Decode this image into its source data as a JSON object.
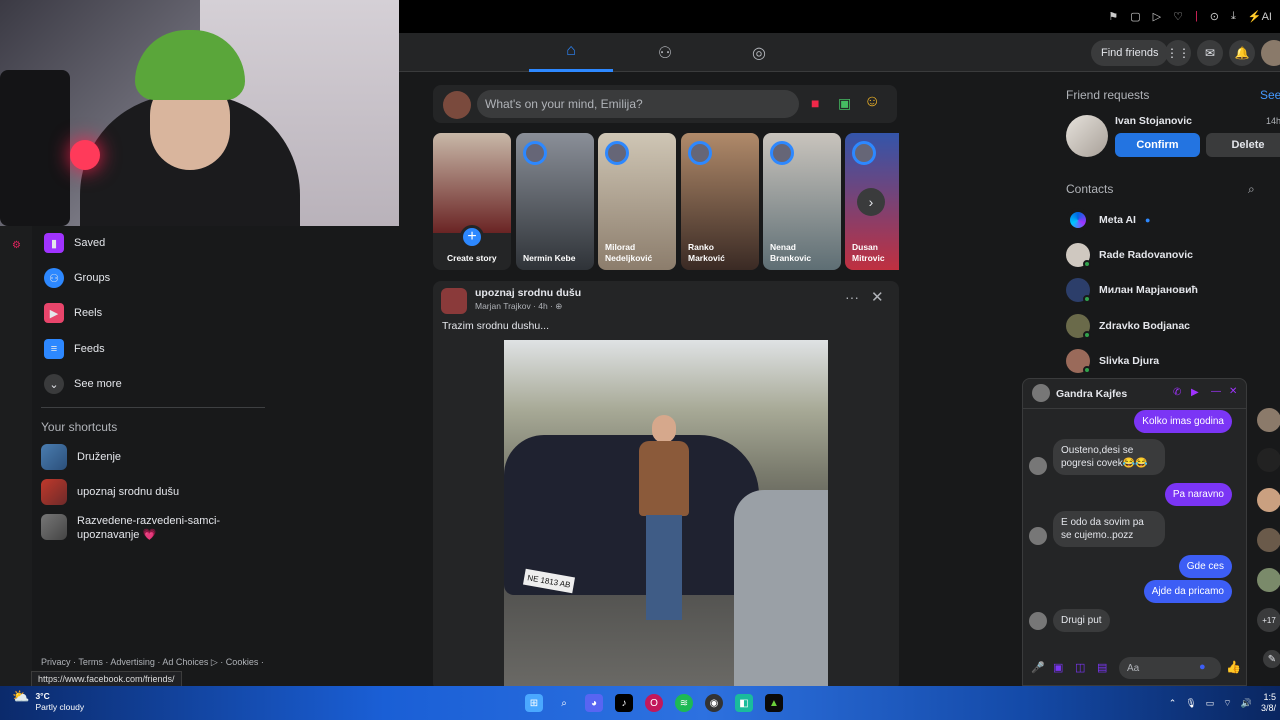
{
  "browser": {
    "extension_icons": [
      "bookmark-icon",
      "window-icon",
      "play-icon",
      "heart-icon",
      "download-icon",
      "sync-icon",
      "ai-icon"
    ],
    "ai_label": "AI",
    "status_url": "https://www.facebook.com/friends/"
  },
  "nav": {
    "tabs": [
      {
        "name": "home",
        "icon": "⌂",
        "active": true
      },
      {
        "name": "friends",
        "icon": "👥",
        "active": false
      },
      {
        "name": "groups",
        "icon": "◎",
        "active": false
      }
    ],
    "find_friends": "Find friends",
    "accent": "#2d88ff"
  },
  "left_menu": {
    "items": [
      {
        "label": "Saved",
        "icon": "bookmark-icon",
        "color": "#a033ff"
      },
      {
        "label": "Groups",
        "icon": "groups-icon",
        "color": "#2d88ff"
      },
      {
        "label": "Reels",
        "icon": "reels-icon",
        "color": "#e8456b"
      },
      {
        "label": "Feeds",
        "icon": "feeds-icon",
        "color": "#2d88ff"
      },
      {
        "label": "See more",
        "icon": "chevron-down-icon",
        "color": "#3a3b3c"
      }
    ],
    "shortcuts_title": "Your shortcuts",
    "shortcuts": [
      {
        "label": "Druženje"
      },
      {
        "label": "upoznaj srodnu dušu"
      },
      {
        "label_line1": "Razvedene-razvedeni-samci-",
        "label_line2": "upoznavanje 💗"
      }
    ],
    "footer": "Privacy · Terms · Advertising · Ad Choices ▷ · Cookies ·"
  },
  "composer": {
    "placeholder": "What's on your mind, Emilija?"
  },
  "stories": [
    {
      "name": "Create story",
      "type": "create"
    },
    {
      "name": "Nermin Kebe"
    },
    {
      "name": "Milorad Nedeljković"
    },
    {
      "name": "Ranko Marković"
    },
    {
      "name": "Nenad Brankovic"
    },
    {
      "name": "Dusan Mitrovic"
    }
  ],
  "post": {
    "group": "upoznaj srodnu dušu",
    "author_meta": "Marjan Trajkov · 4h · ⊕",
    "text": "Trazim srodnu dushu...",
    "plate": "NE 1813 AB"
  },
  "right": {
    "friend_requests_title": "Friend requests",
    "see_all": "See",
    "request": {
      "name": "Ivan Stojanovic",
      "time": "14h",
      "confirm": "Confirm",
      "delete": "Delete"
    },
    "contacts_title": "Contacts",
    "contacts": [
      {
        "name": "Meta AI"
      },
      {
        "name": "Rade Radovanovic"
      },
      {
        "name": "Милан Марјановић"
      },
      {
        "name": "Zdravko Bodjanac"
      },
      {
        "name": "Slivka Djura"
      }
    ]
  },
  "chat": {
    "name": "Gandra Kajfes",
    "messages": [
      {
        "from": "me",
        "text": "Kolko imas godina"
      },
      {
        "from": "them",
        "text": "Ousteno,desi se pogresi covek😂😂"
      },
      {
        "from": "me",
        "text": "Pa naravno"
      },
      {
        "from": "them",
        "text": "E odo da sovim pa se cujemo..pozz"
      },
      {
        "from": "me",
        "text": "Gde ces"
      },
      {
        "from": "me",
        "text": "Ajde da pricamo"
      },
      {
        "from": "them",
        "text": "Drugi put"
      }
    ],
    "input_placeholder": "Aa"
  },
  "edge_badge": "+17",
  "taskbar": {
    "weather_temp": "3°C",
    "weather_desc": "Partly cloudy",
    "clock_time": "1:5",
    "clock_date": "3/8/"
  }
}
